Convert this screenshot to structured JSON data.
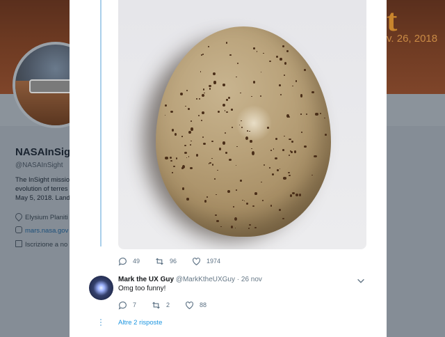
{
  "background_profile": {
    "banner_word": "t",
    "banner_date": "v. 26, 2018",
    "name": "NASAInSigh",
    "handle": "@NASAInSight",
    "bio_lines": [
      "The InSight missio",
      "evolution of terres",
      "May 5, 2018. Land"
    ],
    "location": "Elysium Planiti",
    "website": "mars.nasa.gov",
    "joined": "Iscrizione a no"
  },
  "tweet": {
    "replies": "49",
    "retweets": "96",
    "likes": "1974"
  },
  "reply": {
    "name": "Mark the UX Guy",
    "handle": "@MarkKtheUXGuy",
    "separator": "·",
    "date": "26 nov",
    "text": "Omg too funny!",
    "replies": "7",
    "retweets": "2",
    "likes": "88"
  },
  "more_replies_label": "Altre 2 risposte",
  "icons": {
    "reply": "reply-icon",
    "retweet": "retweet-icon",
    "like": "heart-icon",
    "more": "chevron-down-icon",
    "location": "location-pin-icon",
    "website": "link-icon",
    "joined": "calendar-icon"
  },
  "colors": {
    "link_blue": "#1b95e0",
    "thread_line": "#a9cfea",
    "muted_text": "#657786"
  }
}
